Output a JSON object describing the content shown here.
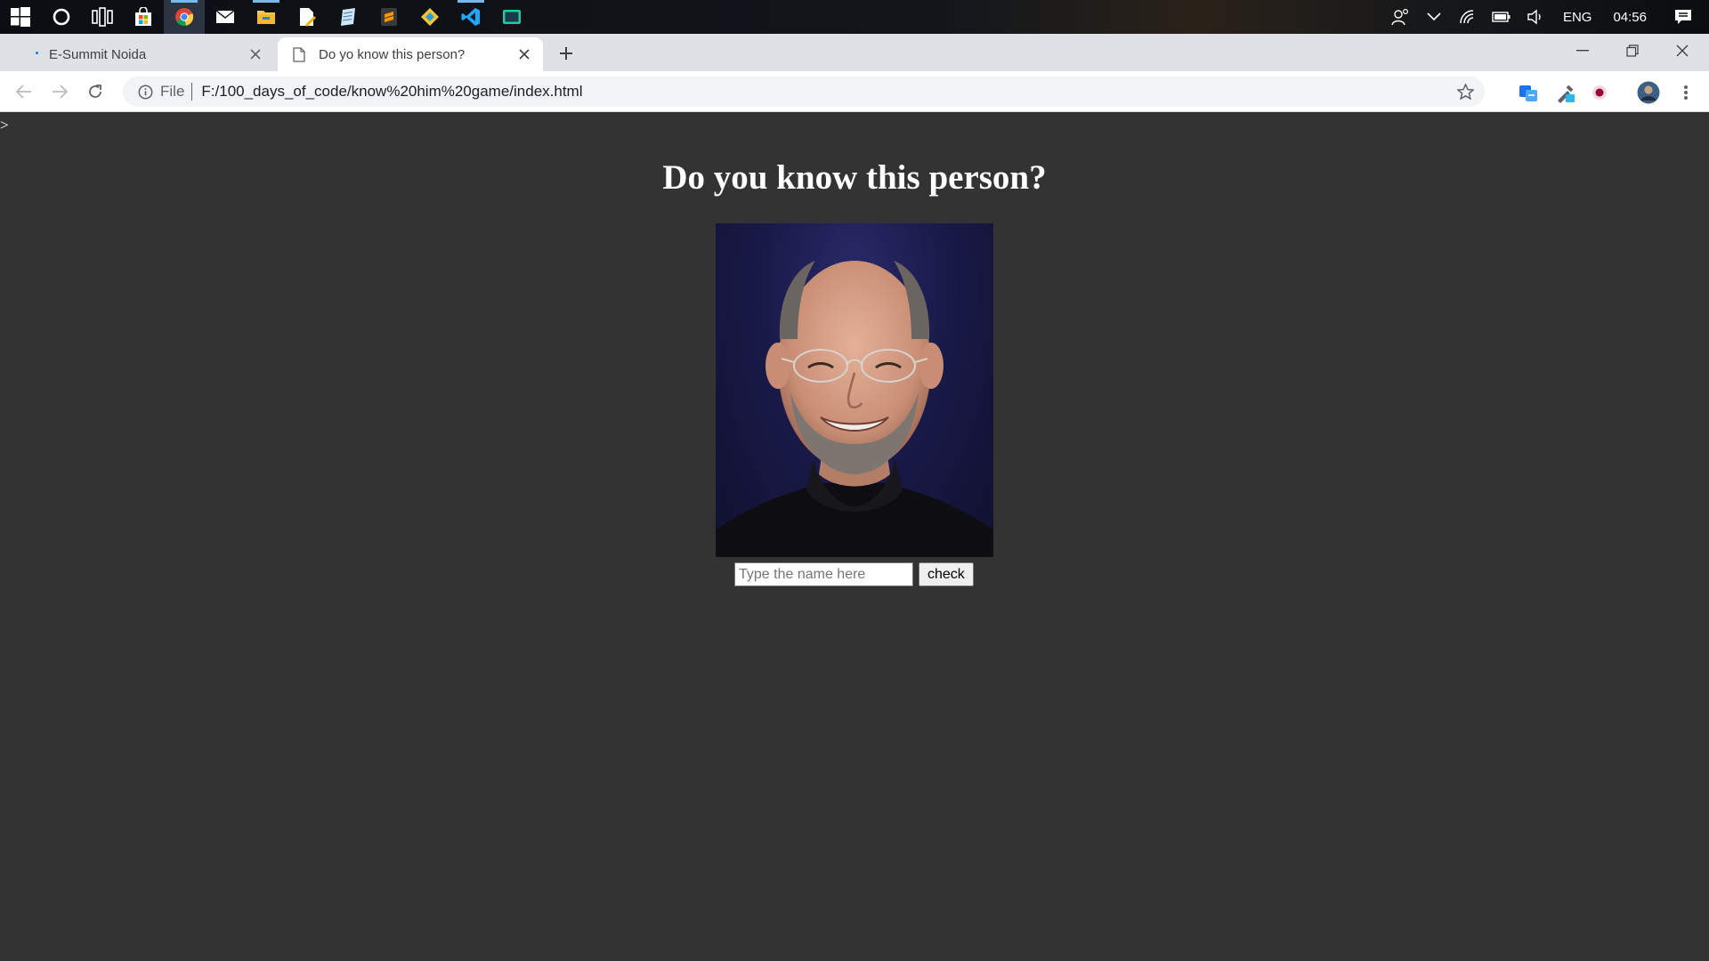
{
  "taskbar": {
    "pinned": [
      "windows-start",
      "search",
      "task-view",
      "store",
      "chrome",
      "mail",
      "file-explorer",
      "document-editor",
      "notepad-app",
      "sublime-text",
      "git-tool",
      "vs-code",
      "terminal-app"
    ],
    "language": "ENG",
    "time": "04:56"
  },
  "tabs": [
    {
      "title": "E-Summit Noida",
      "active": false
    },
    {
      "title": "Do yo know this person?",
      "active": true
    }
  ],
  "toolbar": {
    "scheme_label": "File",
    "url": "F:/100_days_of_code/know%20him%20game/index.html"
  },
  "page": {
    "stray_text": ">",
    "heading": "Do you know this person?",
    "input_placeholder": "Type the name here",
    "button_label": "check"
  }
}
